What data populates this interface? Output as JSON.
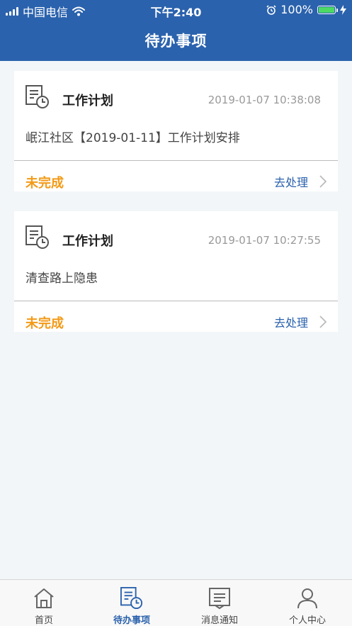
{
  "status_bar": {
    "carrier": "中国电信",
    "time": "下午2:40",
    "battery": "100%"
  },
  "header": {
    "title": "待办事项"
  },
  "tasks": [
    {
      "type": "工作计划",
      "time": "2019-01-07 10:38:08",
      "description": "岷江社区【2019-01-11】工作计划安排",
      "status": "未完成",
      "action": "去处理"
    },
    {
      "type": "工作计划",
      "time": "2019-01-07 10:27:55",
      "description": "清查路上隐患",
      "status": "未完成",
      "action": "去处理"
    }
  ],
  "tabbar": {
    "items": [
      {
        "label": "首页",
        "icon": "home-icon"
      },
      {
        "label": "待办事项",
        "icon": "todo-icon",
        "active": true
      },
      {
        "label": "消息通知",
        "icon": "message-icon"
      },
      {
        "label": "个人中心",
        "icon": "user-icon"
      }
    ]
  },
  "colors": {
    "header_bg": "#2b62ad",
    "status_pending": "#f39a17",
    "action_link": "#2b62ad",
    "page_bg": "#f3f6f9"
  }
}
